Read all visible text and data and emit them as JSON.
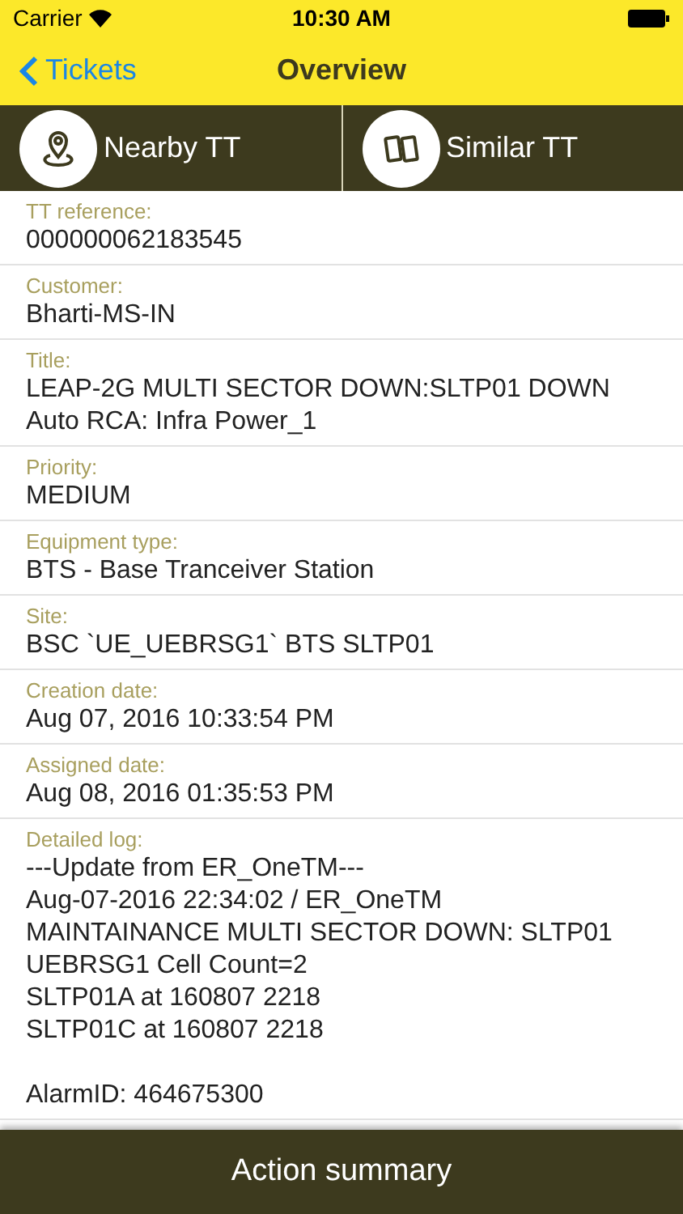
{
  "status_bar": {
    "carrier": "Carrier",
    "time": "10:30 AM"
  },
  "nav": {
    "back": "Tickets",
    "title": "Overview"
  },
  "tabs": [
    {
      "label": "Nearby TT",
      "kind": "pin"
    },
    {
      "label": "Similar TT",
      "kind": "tickets"
    }
  ],
  "fields": [
    {
      "label": "TT reference:",
      "value": "000000062183545"
    },
    {
      "label": "Customer:",
      "value": "Bharti-MS-IN"
    },
    {
      "label": "Title:",
      "value": "LEAP-2G MULTI SECTOR DOWN:SLTP01 DOWN  Auto RCA: Infra Power_1"
    },
    {
      "label": "Priority:",
      "value": "MEDIUM"
    },
    {
      "label": "Equipment type:",
      "value": "BTS - Base Tranceiver Station"
    },
    {
      "label": "Site:",
      "value": "BSC `UE_UEBRSG1` BTS SLTP01"
    },
    {
      "label": "Creation date:",
      "value": "Aug 07, 2016 10:33:54 PM"
    },
    {
      "label": "Assigned date:",
      "value": "Aug 08, 2016 01:35:53 PM"
    },
    {
      "label": "Detailed log:",
      "value": "---Update from ER_OneTM---\nAug-07-2016 22:34:02 / ER_OneTM\nMAINTAINANCE MULTI SECTOR DOWN: SLTP01\nUEBRSG1 Cell Count=2\nSLTP01A at 160807 2218\nSLTP01C at 160807 2218\n\nAlarmID: 464675300"
    }
  ],
  "bottom_button": "Action summary"
}
